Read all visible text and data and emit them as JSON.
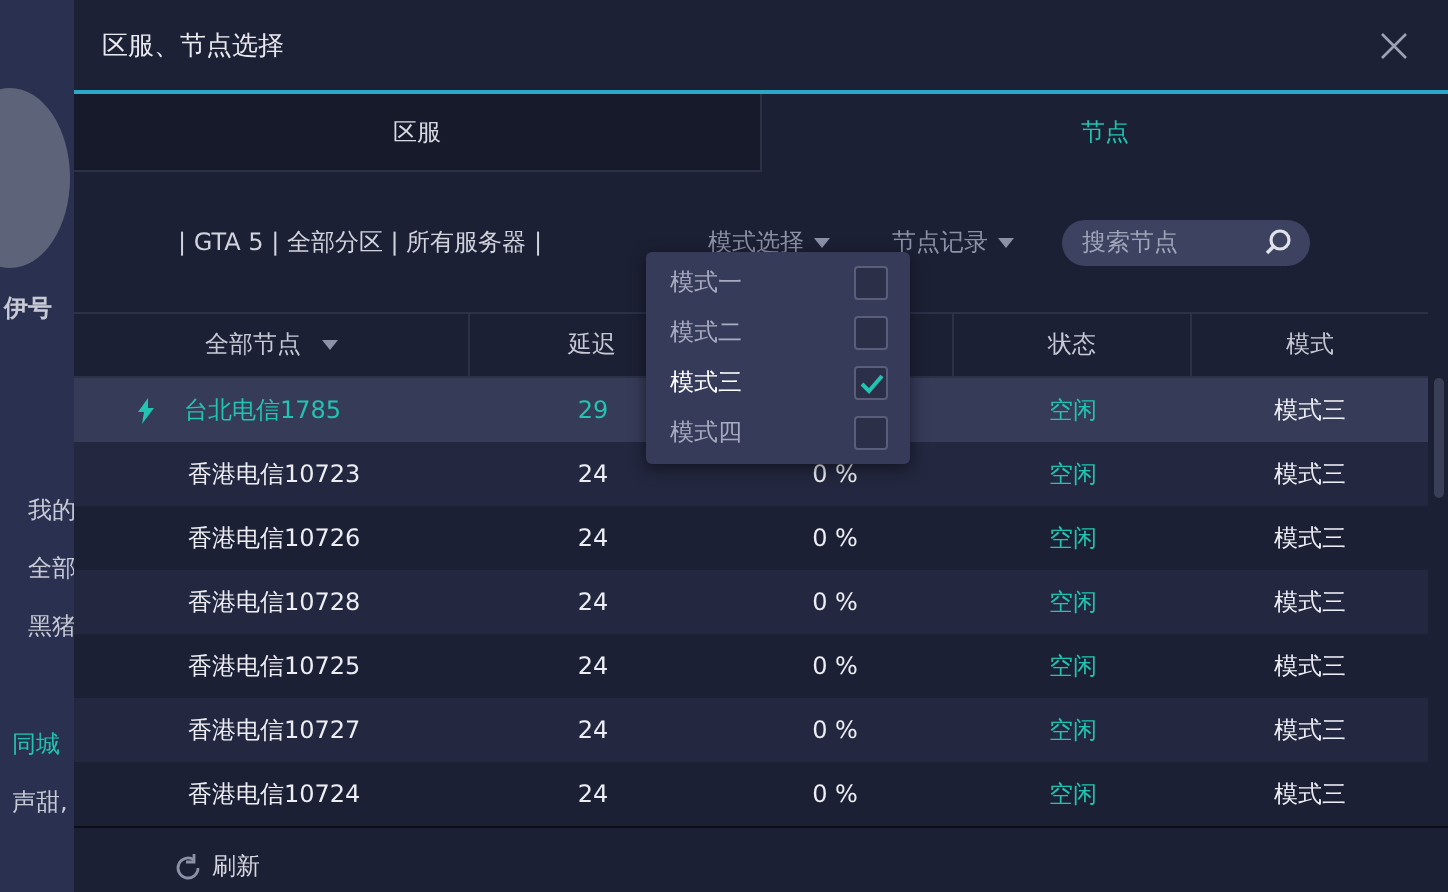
{
  "background_app": {
    "user_name": "伊号",
    "menu": [
      {
        "label": "我的"
      },
      {
        "label": "全部"
      },
      {
        "label": "黑猪"
      }
    ],
    "section": "同城",
    "snippet": "声甜,"
  },
  "dialog": {
    "title": "区服、节点选择",
    "tabs": [
      {
        "label": "区服",
        "selected": false
      },
      {
        "label": "节点",
        "selected": true
      }
    ],
    "breadcrumb": "| GTA 5 | 全部分区 | 所有服务器 |",
    "mode_select": "模式选择",
    "node_history": "节点记录",
    "search": {
      "placeholder": "搜索节点"
    },
    "mode_menu": [
      {
        "label": "模式一",
        "checked": false
      },
      {
        "label": "模式二",
        "checked": false
      },
      {
        "label": "模式三",
        "checked": true
      },
      {
        "label": "模式四",
        "checked": false
      }
    ],
    "table": {
      "columns": [
        {
          "label": "全部节点"
        },
        {
          "label": "延迟"
        },
        {},
        {
          "label": "状态"
        },
        {
          "label": "模式"
        }
      ],
      "rows": [
        {
          "node": "台北电信1785",
          "latency": "29",
          "status": "空闲",
          "mode": "模式三",
          "selected": true
        },
        {
          "node": "香港电信10723",
          "latency": "24",
          "loss": "0 %",
          "status": "空闲",
          "mode": "模式三",
          "selected": false
        },
        {
          "node": "香港电信10726",
          "latency": "24",
          "loss": "0 %",
          "status": "空闲",
          "mode": "模式三",
          "selected": false
        },
        {
          "node": "香港电信10728",
          "latency": "24",
          "loss": "0 %",
          "status": "空闲",
          "mode": "模式三",
          "selected": false
        },
        {
          "node": "香港电信10725",
          "latency": "24",
          "loss": "0 %",
          "status": "空闲",
          "mode": "模式三",
          "selected": false
        },
        {
          "node": "香港电信10727",
          "latency": "24",
          "loss": "0 %",
          "status": "空闲",
          "mode": "模式三",
          "selected": false
        },
        {
          "node": "香港电信10724",
          "latency": "24",
          "loss": "0 %",
          "status": "空闲",
          "mode": "模式三",
          "selected": false
        }
      ]
    },
    "refresh": "刷新"
  }
}
